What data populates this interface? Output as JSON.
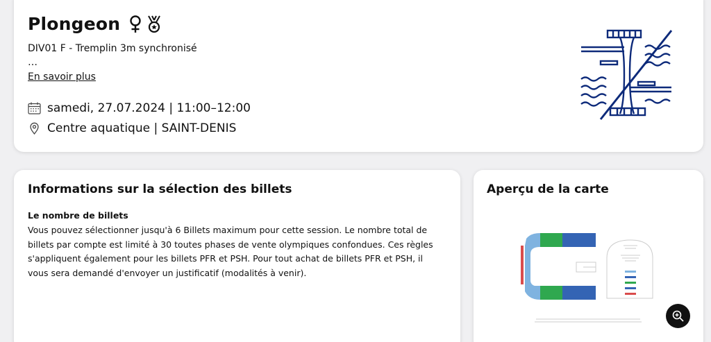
{
  "event": {
    "title": "Plongeon",
    "subtitle": "DIV01 F - Tremplin 3m synchronisé",
    "ellipsis": "…",
    "more_link": "En savoir plus",
    "date": "samedi, 27.07.2024 | 11:00–12:00",
    "venue": "Centre aquatique | SAINT-DENIS",
    "icons": [
      "female-symbol-icon",
      "medal-icon",
      "calendar-icon",
      "location-pin-icon",
      "diving-pictogram"
    ],
    "accent_color": "#0d2a7a"
  },
  "info": {
    "title": "Informations sur la sélection des billets",
    "subtitle": "Le nombre de billets",
    "body": "Vous pouvez sélectionner jusqu'à 6 Billets maximum pour cette session. Le nombre total de billets par compte est limité à 30 toutes phases de vente olympiques confondues. Ces règles s'appliquent également pour les billets PFR et PSH. Pour tout achat de billets PFR et PSH, il vous sera demandé d'envoyer un justificatif (modalités à venir)."
  },
  "map": {
    "title": "Aperçu de la carte",
    "zoom_icon": "zoom-in-icon",
    "colors": {
      "light_blue": "#7fb3e0",
      "green": "#2fa84f",
      "dark_blue": "#3464b4",
      "red": "#d94c4c"
    }
  }
}
